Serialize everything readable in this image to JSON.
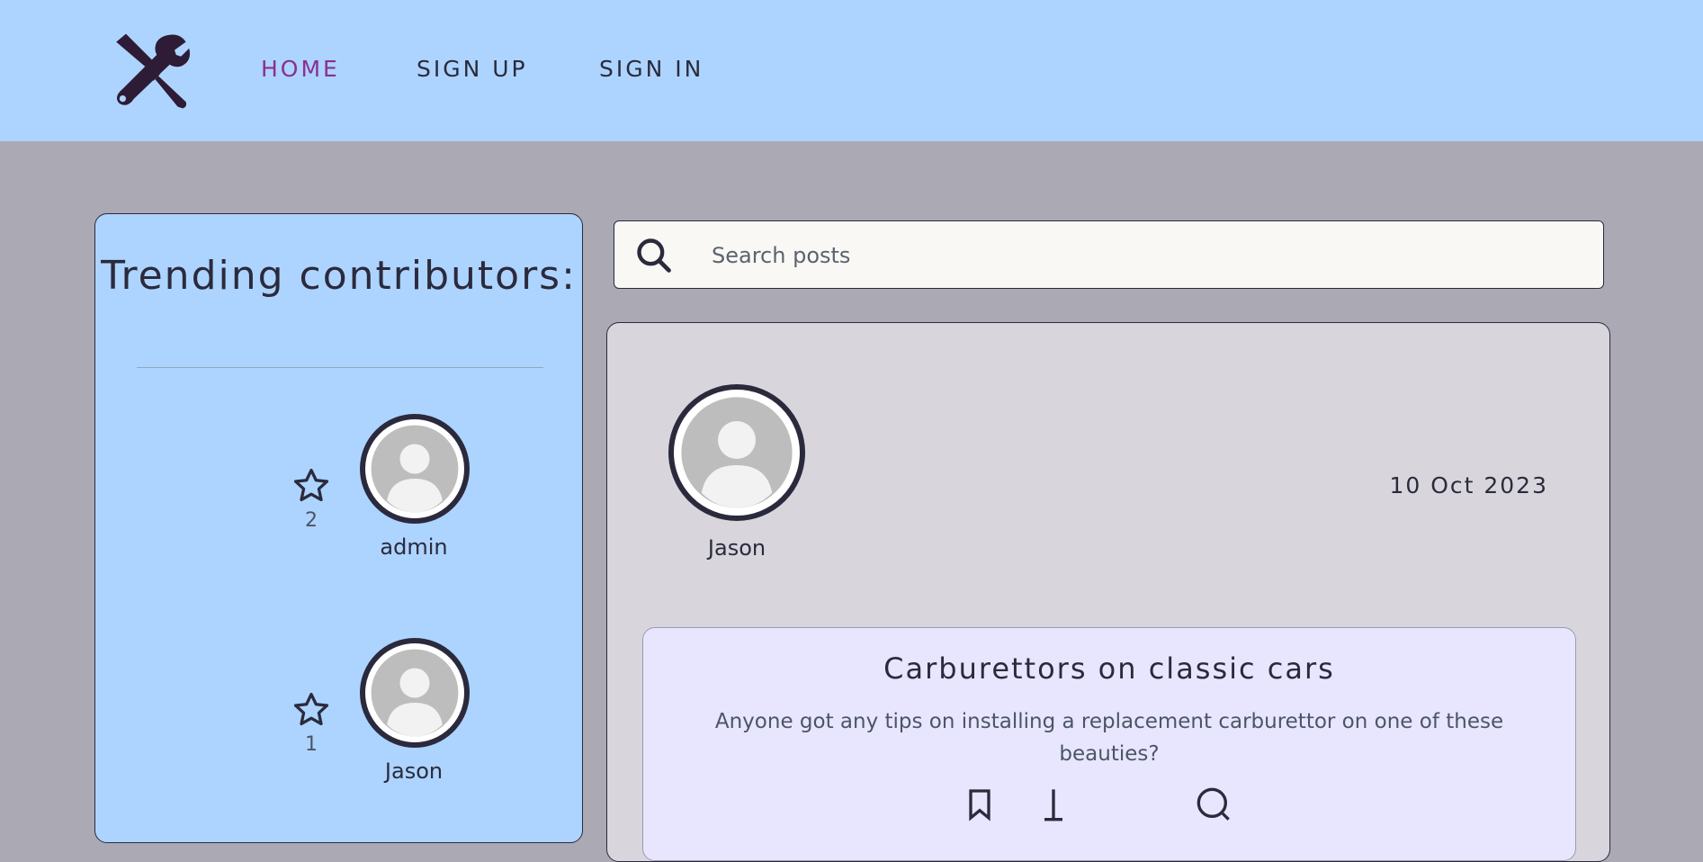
{
  "nav": {
    "items": [
      {
        "label": "HOME",
        "active": true
      },
      {
        "label": "SIGN UP",
        "active": false
      },
      {
        "label": "SIGN IN",
        "active": false
      }
    ]
  },
  "sidebar": {
    "title": "Trending contributors:",
    "contributors": [
      {
        "name": "admin",
        "score": "2"
      },
      {
        "name": "Jason",
        "score": "1"
      }
    ]
  },
  "search": {
    "placeholder": "Search posts",
    "icon": "search-icon"
  },
  "post": {
    "author": "Jason",
    "date": "10 Oct 2023",
    "title": "Carburettors on classic cars",
    "content": "Anyone got any tips on installing a replacement carburettor on one of these beauties?",
    "actions": [
      "bookmark-icon",
      "like-icon",
      "comment-icon"
    ]
  },
  "colors": {
    "header_bg": "#add4fe",
    "page_bg": "#aaa9b4",
    "nav_active": "#8a2f93",
    "text_dark": "#2b2a3d",
    "post_bg": "#d8d6dc",
    "post_body_bg": "#e8e6fe",
    "search_bg": "#f9f8f4"
  }
}
